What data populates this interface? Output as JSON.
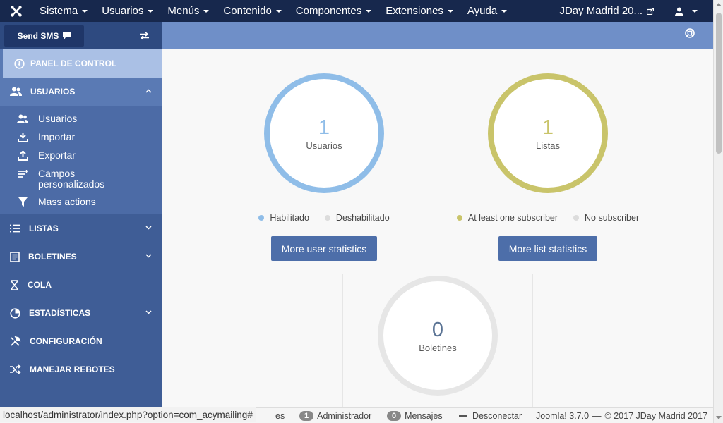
{
  "navbar": {
    "menus": [
      "Sistema",
      "Usuarios",
      "Menús",
      "Contenido",
      "Componentes",
      "Extensiones",
      "Ayuda"
    ],
    "site_link": "JDay Madrid 20..."
  },
  "sidebar": {
    "send_sms": "Send SMS",
    "panel": "PANEL DE CONTROL",
    "usuarios": "USUARIOS",
    "sub": [
      "Usuarios",
      "Importar",
      "Exportar",
      "Campos personalizados",
      "Mass actions"
    ],
    "sections": [
      "LISTAS",
      "BOLETINES",
      "COLA",
      "ESTADÍSTICAS",
      "CONFIGURACIÓN",
      "MANEJAR REBOTES"
    ]
  },
  "stats": {
    "users": {
      "count": "1",
      "caption": "Usuarios",
      "legend": [
        "Habilitado",
        "Deshabilitado"
      ],
      "button": "More user statistics",
      "color": "#8fbde8"
    },
    "lists": {
      "count": "1",
      "caption": "Listas",
      "legend": [
        "At least one subscriber",
        "No subscriber"
      ],
      "button": "More list statistics",
      "color": "#c9c46a"
    },
    "newsletters": {
      "count": "0",
      "caption": "Boletines",
      "color": "#e6e6e6"
    }
  },
  "footer": {
    "url": "localhost/administrator/index.php?option=com_acymailing#",
    "partial": "es",
    "admin_count": "1",
    "admin_label": "Administrador",
    "msg_count": "0",
    "msg_label": "Mensajes",
    "logout": "Desconectar",
    "version": "Joomla! 3.7.0",
    "copyright": "© 2017 JDay Madrid 2017"
  }
}
